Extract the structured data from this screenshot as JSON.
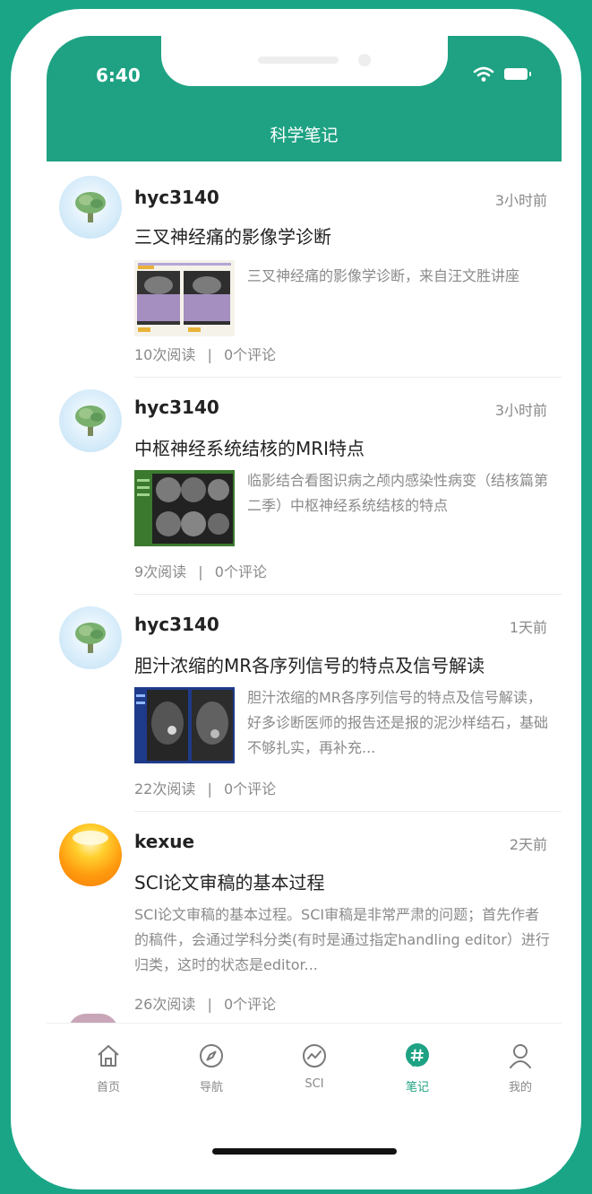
{
  "status_bar": {
    "time": "6:40"
  },
  "header": {
    "title": "科学笔记"
  },
  "posts": [
    {
      "username": "hyc3140",
      "time": "3小时前",
      "title": "三叉神经痛的影像学诊断",
      "desc": "三叉神经痛的影像学诊断，来自汪文胜讲座",
      "reads": "10次阅读",
      "sep": "|",
      "comments": "0个评论",
      "avatar": "tree-avatar",
      "thumbnail": "mri-axial-purple"
    },
    {
      "username": "hyc3140",
      "time": "3小时前",
      "title": "中枢神经系统结核的MRI特点",
      "desc": "临影结合看图识病之颅内感染性病变（结核篇第二季）中枢神经系统结核的特点",
      "reads": "9次阅读",
      "sep": "|",
      "comments": "0个评论",
      "avatar": "tree-avatar",
      "thumbnail": "mri-grid-green"
    },
    {
      "username": "hyc3140",
      "time": "1天前",
      "title": "胆汁浓缩的MR各序列信号的特点及信号解读",
      "desc": "胆汁浓缩的MR各序列信号的特点及信号解读，好多诊断医师的报告还是报的泥沙样结石，基础不够扎实，再补充...",
      "reads": "22次阅读",
      "sep": "|",
      "comments": "0个评论",
      "avatar": "tree-avatar",
      "thumbnail": "mri-abdomen-blue"
    },
    {
      "username": "kexue",
      "time": "2天前",
      "title": "SCI论文审稿的基本过程",
      "desc": "SCI论文审稿的基本过程。SCI审稿是非常严肃的问题；首先作者的稿件，会通过学科分类(有时是通过指定handling editor）进行归类，这时的状态是editor...",
      "reads": "26次阅读",
      "sep": "|",
      "comments": "0个评论",
      "avatar": "sun-avatar"
    }
  ],
  "tabs": [
    {
      "label": "首页",
      "icon": "home-icon"
    },
    {
      "label": "导航",
      "icon": "compass-icon"
    },
    {
      "label": "SCI",
      "icon": "chart-circle-icon"
    },
    {
      "label": "笔记",
      "icon": "hash-icon",
      "active": true
    },
    {
      "label": "我的",
      "icon": "user-icon"
    }
  ],
  "colors": {
    "brand": "#1ea283",
    "background": "#1aa686",
    "text_secondary": "#8a8a8a"
  }
}
